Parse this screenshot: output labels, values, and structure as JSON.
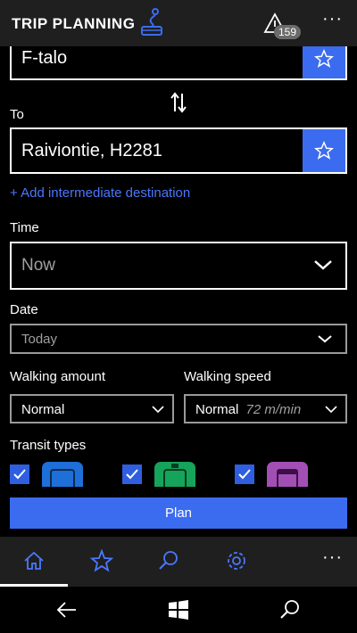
{
  "header": {
    "title": "TRIP PLANNING",
    "logo_icon": "bus-route-icon",
    "alerts_count": "159",
    "more": "···"
  },
  "from": {
    "value": "F-talo"
  },
  "to": {
    "label": "To",
    "value": "Raiviontie, H2281"
  },
  "add_intermediate": "+ Add intermediate destination",
  "time": {
    "label": "Time",
    "value": "Now"
  },
  "date": {
    "label": "Date",
    "value": "Today"
  },
  "walking_amount": {
    "label": "Walking amount",
    "value": "Normal"
  },
  "walking_speed": {
    "label": "Walking speed",
    "value": "Normal",
    "detail": "72 m/min"
  },
  "transit": {
    "label": "Transit types",
    "types": [
      {
        "name": "bus",
        "checked": true,
        "color": "#1e6fd8"
      },
      {
        "name": "tram",
        "checked": true,
        "color": "#16a35a"
      },
      {
        "name": "metro",
        "checked": true,
        "color": "#a24fb5"
      }
    ]
  },
  "plan_button": "Plan",
  "bottom_nav": {
    "items": [
      "home-icon",
      "favorites-icon",
      "search-icon",
      "settings-icon"
    ],
    "more": "···"
  },
  "colors": {
    "accent": "#3b6cf0",
    "link": "#4a78ff",
    "bar_bg": "#1f1f1f"
  }
}
